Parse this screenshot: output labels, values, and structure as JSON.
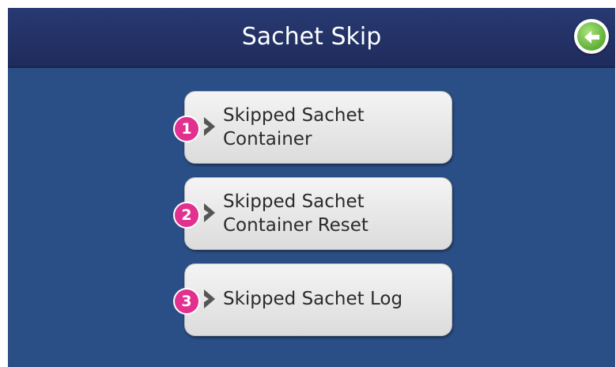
{
  "header": {
    "title": "Sachet Skip",
    "back_icon": "back-arrow-icon"
  },
  "menu": {
    "items": [
      {
        "badge": "1",
        "line1": "Skipped Sachet",
        "line2": "Container"
      },
      {
        "badge": "2",
        "line1": "Skipped Sachet",
        "line2": "Container Reset"
      },
      {
        "badge": "3",
        "line1": "Skipped Sachet Log",
        "line2": ""
      }
    ]
  },
  "colors": {
    "background": "#2a4f86",
    "header": "#222f63",
    "button": "#e6e6e6",
    "badge": "#e2308f",
    "back_button": "#6dbd3f"
  }
}
